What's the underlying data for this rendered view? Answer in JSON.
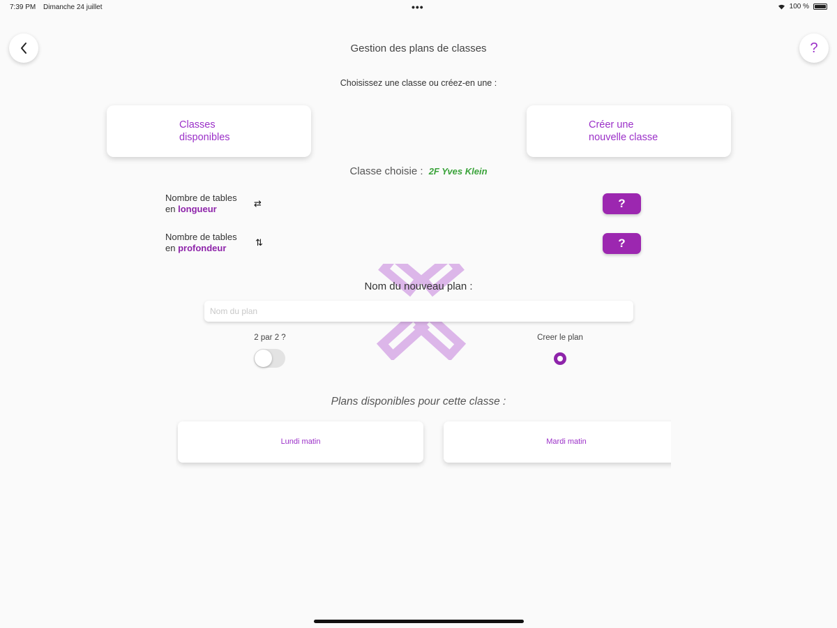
{
  "status": {
    "time": "7:39 PM",
    "date": "Dimanche 24 juillet",
    "dots": "•••",
    "battery": "100 %",
    "battery_level": 1.0
  },
  "header": {
    "title": "Gestion des plans de classes",
    "help_label": "?"
  },
  "selection": {
    "prompt": "Choisissez une classe ou créez-en une :",
    "available_classes_line1": "Classes",
    "available_classes_line2": "disponibles",
    "create_class_line1": "Créer une",
    "create_class_line2": "nouvelle classe",
    "chosen_label": "Classe choisie :",
    "chosen_value": "2F Yves Klein"
  },
  "tables": {
    "length_line1": "Nombre de tables",
    "length_prefix": "en",
    "length_em": "longueur",
    "length_icon": "⇄",
    "length_value": "?",
    "depth_line1": "Nombre de tables",
    "depth_prefix": "en",
    "depth_em": "profondeur",
    "depth_icon": "⇅",
    "depth_value": "?"
  },
  "new_plan": {
    "label": "Nom du nouveau plan :",
    "placeholder": "Nom du plan",
    "value": "",
    "two_by_two_label": "2 par 2 ?",
    "two_by_two_on": false,
    "create_label": "Creer le plan"
  },
  "plans": {
    "heading": "Plans disponibles pour cette classe :",
    "items": [
      {
        "label": "Lundi matin"
      },
      {
        "label": "Mardi matin"
      }
    ]
  },
  "colors": {
    "accent": "#9c27b0",
    "chosen": "#3aa33a",
    "background": "#fafafa"
  }
}
